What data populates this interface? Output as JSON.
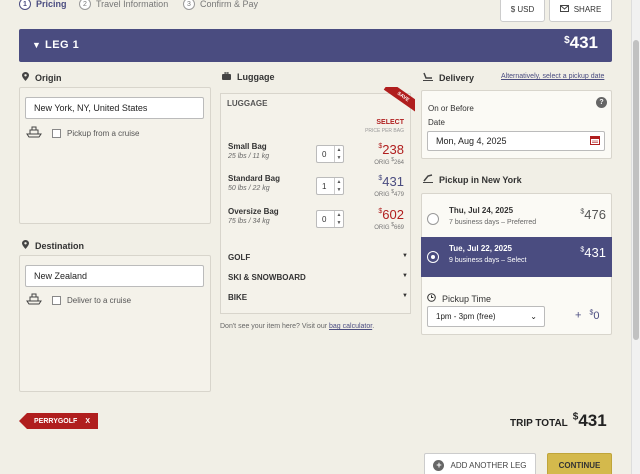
{
  "steps": [
    {
      "num": "1",
      "label": "Pricing"
    },
    {
      "num": "2",
      "label": "Travel Information"
    },
    {
      "num": "3",
      "label": "Confirm & Pay"
    }
  ],
  "top_buttons": {
    "currency": "$ USD",
    "share": "SHARE"
  },
  "leg": {
    "title": "LEG 1",
    "price": "431",
    "currency_symbol": "$"
  },
  "origin": {
    "heading": "Origin",
    "value": "New York, NY, United States",
    "cruise_label": "Pickup from a cruise"
  },
  "destination": {
    "heading": "Destination",
    "value": "New Zealand",
    "cruise_label": "Deliver to a cruise"
  },
  "luggage": {
    "heading": "Luggage",
    "panel_title": "LUGGAGE",
    "save_ribbon": "SAVE",
    "select": "SELECT",
    "price_per_bag": "PRICE PER BAG",
    "bags": [
      {
        "name": "Small Bag",
        "weight": "25 lbs / 11 kg",
        "qty": "0",
        "price": "238",
        "orig": "264",
        "active": false
      },
      {
        "name": "Standard Bag",
        "weight": "50 lbs / 22 kg",
        "qty": "1",
        "price": "431",
        "orig": "479",
        "active": true
      },
      {
        "name": "Oversize Bag",
        "weight": "75 lbs / 34 kg",
        "qty": "0",
        "price": "602",
        "orig": "669",
        "active": false
      }
    ],
    "orig_label": "ORIG",
    "categories": [
      "GOLF",
      "SKI & SNOWBOARD",
      "BIKE"
    ],
    "help_text": "Don't see your item here? Visit our",
    "help_link": "bag calculator"
  },
  "delivery": {
    "heading": "Delivery",
    "alt_link": "Alternatively, select a pickup date",
    "on_or_before": "On or Before",
    "date_label": "Date",
    "date_value": "Mon, Aug 4, 2025"
  },
  "pickup": {
    "heading": "Pickup in New York",
    "options": [
      {
        "date": "Thu, Jul 24, 2025",
        "detail": "7 business days – Preferred",
        "price": "476",
        "selected": false
      },
      {
        "date": "Tue, Jul 22, 2025",
        "detail": "9 business days – Select",
        "price": "431",
        "selected": true
      }
    ],
    "time_label": "Pickup Time",
    "time_value": "1pm - 3pm (free)",
    "addon": "+",
    "addon_price": "0"
  },
  "promo": {
    "code": "PERRYGOLF",
    "remove": "X"
  },
  "trip_total": {
    "label": "TRIP TOTAL",
    "price": "431"
  },
  "footer": {
    "add_leg": "ADD ANOTHER LEG",
    "continue": "CONTINUE"
  },
  "colors": {
    "primary": "#4a4c80",
    "accent_red": "#b01e1e",
    "continue_bg": "#d4b94c",
    "page_bg": "#f1efe6"
  }
}
